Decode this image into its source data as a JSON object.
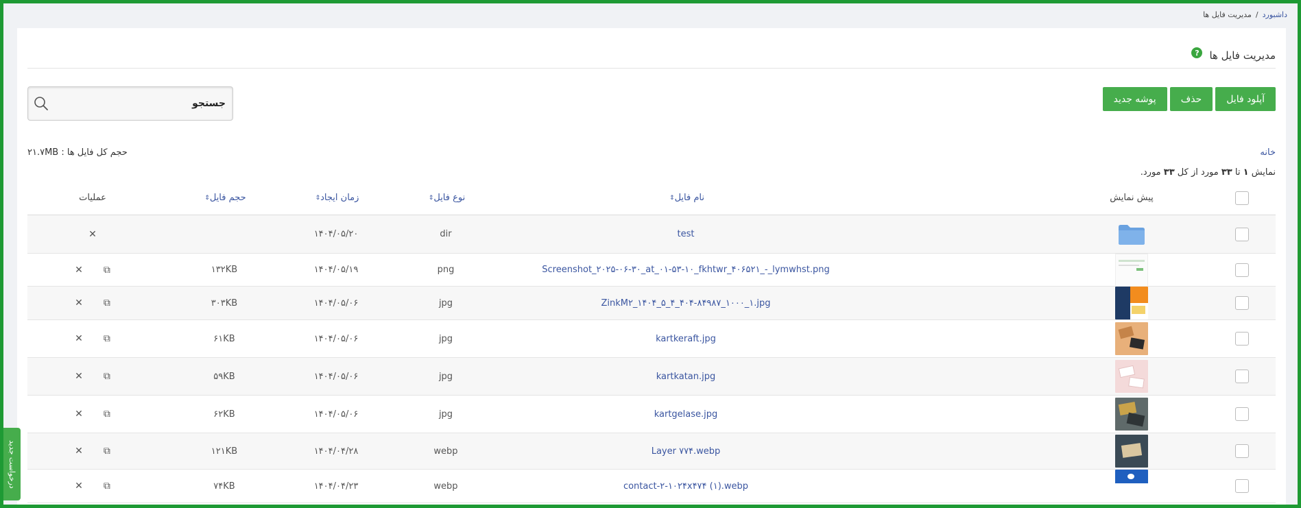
{
  "breadcrumb": {
    "home": "داشبورد",
    "separator": "/",
    "current": "مدیریت فایل ها"
  },
  "page": {
    "title": "مدیریت فایل ها",
    "help": "?"
  },
  "toolbar": {
    "upload": "آپلود فایل",
    "delete": "حذف",
    "new_folder": "پوشه جدید"
  },
  "search": {
    "placeholder": "جستجو"
  },
  "nav": {
    "home": "خانه"
  },
  "total_size": "حجم کل فایل ها : ۲۱.۷MB",
  "summary": {
    "prefix": "نمایش",
    "from": "۱",
    "to_word": "تا",
    "to": "۳۳",
    "mid": "مورد از کل",
    "total": "۳۳",
    "suffix": "مورد."
  },
  "table": {
    "headers": {
      "preview": "پیش نمایش",
      "name": "نام فایل",
      "type": "نوع فایل",
      "created": "زمان ایجاد",
      "size": "حجم فایل",
      "ops": "عملیات"
    },
    "rows": [
      {
        "name": "test",
        "type": "dir",
        "date": "۱۴۰۴/۰۵/۲۰",
        "size": "",
        "preview": "folder"
      },
      {
        "name": "Screenshot_۲۰۲۵-۰۶-۳۰_at_۰۱-۵۳-۱۰_fkhtwr_۴۰۶۵۲۱_-_lymwhst.png",
        "type": "png",
        "date": "۱۴۰۴/۰۵/۱۹",
        "size": "۱۳۲KB",
        "preview": "screenshot"
      },
      {
        "name": "ZinkM۲_۱۴۰۴_۵_۴_۴۰۴-۸۴۹۸۷_۱۰۰۰_۱.jpg",
        "type": "jpg",
        "date": "۱۴۰۴/۰۵/۰۶",
        "size": "۳۰۳KB",
        "preview": "poster"
      },
      {
        "name": "kartkeraft.jpg",
        "type": "jpg",
        "date": "۱۴۰۴/۰۵/۰۶",
        "size": "۶۱KB",
        "preview": "kraft"
      },
      {
        "name": "kartkatan.jpg",
        "type": "jpg",
        "date": "۱۴۰۴/۰۵/۰۶",
        "size": "۵۹KB",
        "preview": "katan"
      },
      {
        "name": "kartgelase.jpg",
        "type": "jpg",
        "date": "۱۴۰۴/۰۵/۰۶",
        "size": "۶۲KB",
        "preview": "gelase"
      },
      {
        "name": "Layer ۷۷۴.webp",
        "type": "webp",
        "date": "۱۴۰۴/۰۴/۲۸",
        "size": "۱۲۱KB",
        "preview": "layer"
      },
      {
        "name": "contact-۲-۱۰۲۴x۴۷۴ (۱).webp",
        "type": "webp",
        "date": "۱۴۰۴/۰۴/۲۳",
        "size": "۷۴KB",
        "preview": "contact"
      }
    ]
  },
  "side_tab": "درخواست جدید",
  "colors": {
    "accent": "#46ad4c",
    "frame": "#1e9a34",
    "link": "#3a55a0"
  },
  "icons": {
    "help": "question-circle-icon",
    "search": "magnifier-icon",
    "copy": "copy-icon",
    "delete": "close-icon",
    "folder": "folder-icon",
    "sort": "sort-arrows-icon"
  }
}
